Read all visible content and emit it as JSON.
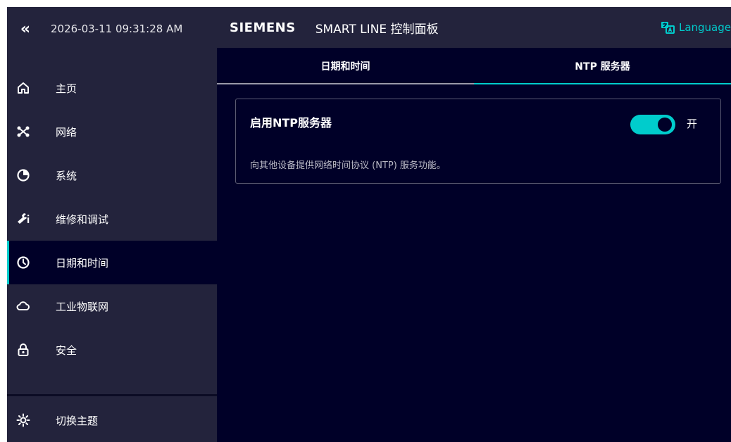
{
  "sidebar": {
    "collapse_glyph": "«",
    "datetime": "2026-03-11 09:31:28 AM",
    "items": [
      {
        "label": "主页",
        "icon": "home-icon"
      },
      {
        "label": "网络",
        "icon": "network-icon"
      },
      {
        "label": "系统",
        "icon": "pie-chart-icon"
      },
      {
        "label": "维修和调试",
        "icon": "wrench-icon"
      },
      {
        "label": "日期和时间",
        "icon": "clock-icon",
        "active": true
      },
      {
        "label": "工业物联网",
        "icon": "cloud-icon"
      },
      {
        "label": "安全",
        "icon": "lock-icon"
      }
    ],
    "theme_label": "切换主题",
    "theme_icon": "sun-icon"
  },
  "header": {
    "brand": "SIEMENS",
    "title": "SMART LINE 控制面板",
    "language_label": "Language"
  },
  "tabs": [
    {
      "label": "日期和时间",
      "active": false
    },
    {
      "label": "NTP 服务器",
      "active": true
    }
  ],
  "ntp_card": {
    "title": "启用NTP服务器",
    "toggle_state": "开",
    "toggle_on": true,
    "description": "向其他设备提供网络时间协议 (NTP) 服务功能。"
  },
  "colors": {
    "accent": "#00cccc",
    "background": "#000028",
    "panel": "#23233c"
  }
}
